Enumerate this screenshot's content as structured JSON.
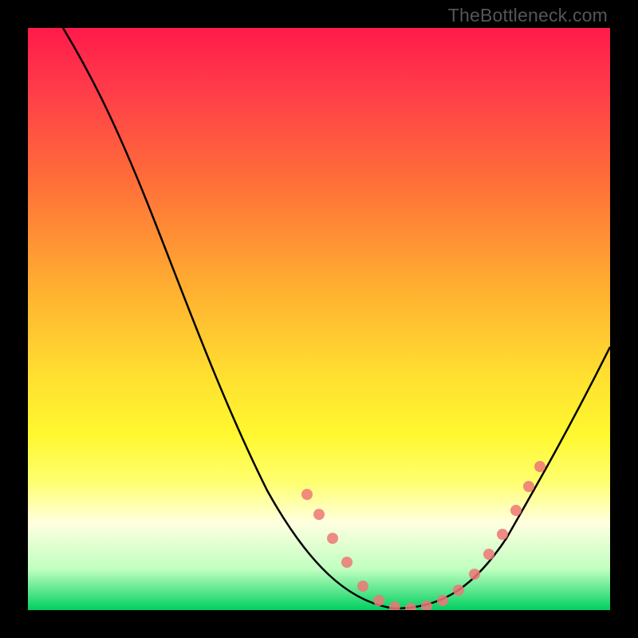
{
  "watermark": "TheBottleneck.com",
  "chart_data": {
    "type": "line",
    "title": "",
    "xlabel": "",
    "ylabel": "",
    "xlim": [
      0,
      100
    ],
    "ylim": [
      0,
      100
    ],
    "grid": false,
    "series": [
      {
        "name": "bottleneck-curve",
        "x": [
          6,
          12,
          18,
          24,
          30,
          36,
          42,
          46,
          50,
          54,
          58,
          62,
          65,
          68,
          72,
          76,
          80,
          84,
          88,
          92,
          96,
          100
        ],
        "y": [
          100,
          94,
          86,
          76,
          64,
          51,
          38,
          28,
          19,
          12,
          7,
          3,
          1,
          0,
          0,
          1,
          5,
          12,
          20,
          29,
          38,
          46
        ]
      },
      {
        "name": "highlight-dots",
        "x": [
          48,
          50,
          52,
          55,
          58,
          60,
          63,
          66,
          69,
          72,
          75,
          78,
          80,
          82,
          84,
          86,
          88
        ],
        "y": [
          22,
          18,
          14,
          10,
          7,
          5,
          3,
          1,
          0,
          0,
          1,
          3,
          5,
          8,
          12,
          16,
          20
        ]
      }
    ],
    "gradient_stops": [
      {
        "pos": 0,
        "color": "#ff1a4a"
      },
      {
        "pos": 10,
        "color": "#ff3a4a"
      },
      {
        "pos": 25,
        "color": "#ff6a3a"
      },
      {
        "pos": 45,
        "color": "#ffb030"
      },
      {
        "pos": 60,
        "color": "#ffe030"
      },
      {
        "pos": 70,
        "color": "#fff830"
      },
      {
        "pos": 78,
        "color": "#ffff70"
      },
      {
        "pos": 85,
        "color": "#ffffe0"
      },
      {
        "pos": 93,
        "color": "#c0ffc0"
      },
      {
        "pos": 100,
        "color": "#00d060"
      }
    ]
  }
}
